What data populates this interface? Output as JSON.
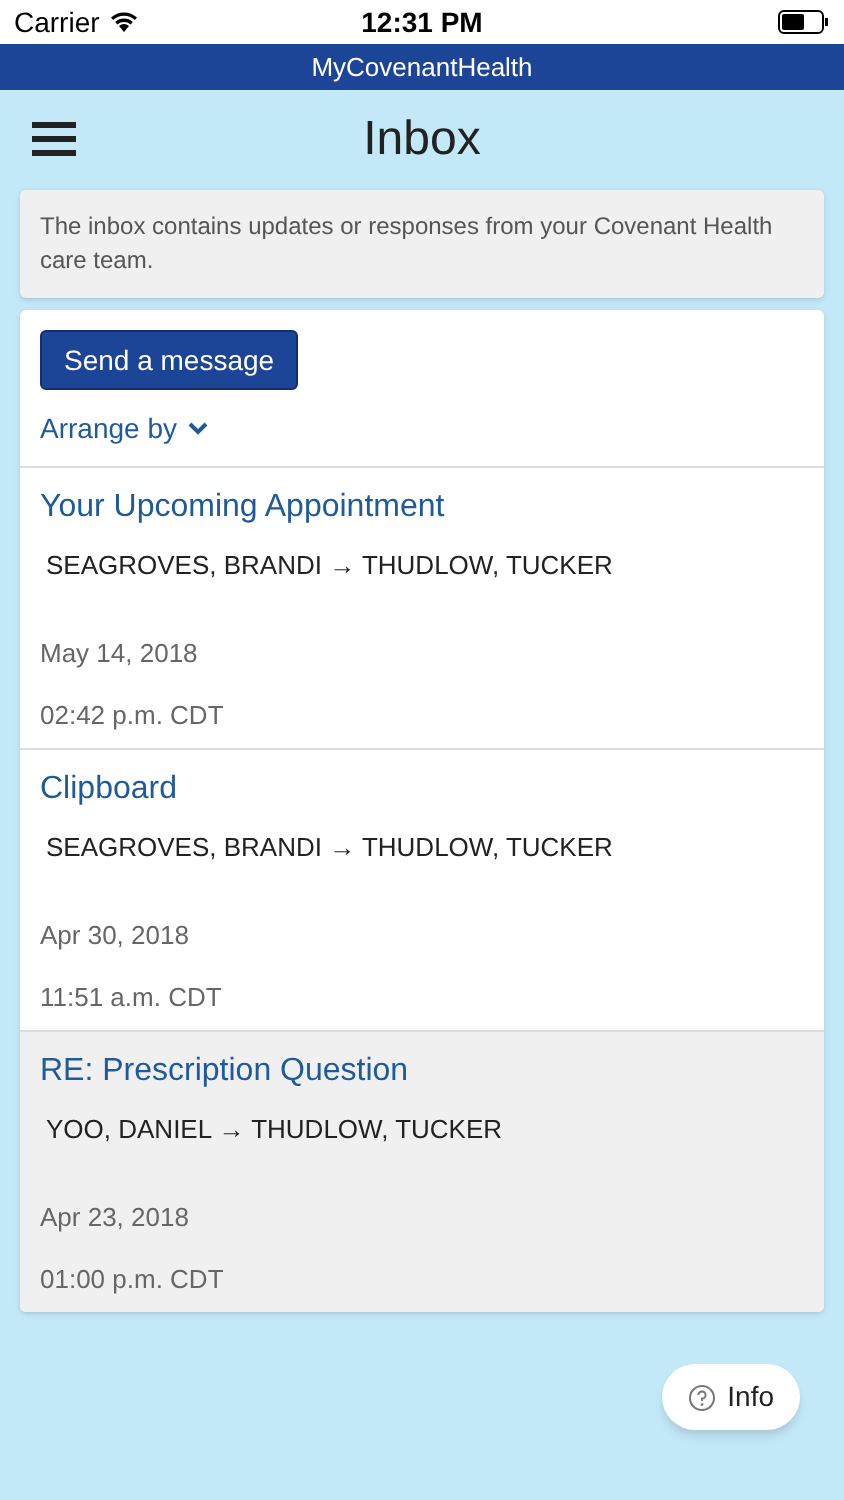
{
  "status_bar": {
    "carrier": "Carrier",
    "time": "12:31 PM"
  },
  "app_bar": {
    "title": "MyCovenantHealth"
  },
  "header": {
    "title": "Inbox"
  },
  "notice": "The inbox contains updates or responses from your Covenant Health care team.",
  "send_button": "Send a message",
  "arrange_by": "Arrange by",
  "messages": [
    {
      "subject": "Your Upcoming Appointment",
      "participants": "SEAGROVES, BRANDI → THUDLOW, TUCKER",
      "date": "May 14, 2018",
      "time": "02:42 p.m. CDT",
      "selected": false
    },
    {
      "subject": "Clipboard",
      "participants": "SEAGROVES, BRANDI → THUDLOW, TUCKER",
      "date": "Apr 30, 2018",
      "time": "11:51 a.m. CDT",
      "selected": false
    },
    {
      "subject": "RE: Prescription Question",
      "participants": "YOO, DANIEL → THUDLOW, TUCKER",
      "date": "Apr 23, 2018",
      "time": "01:00 p.m. CDT",
      "selected": true
    }
  ],
  "info_button": "Info"
}
